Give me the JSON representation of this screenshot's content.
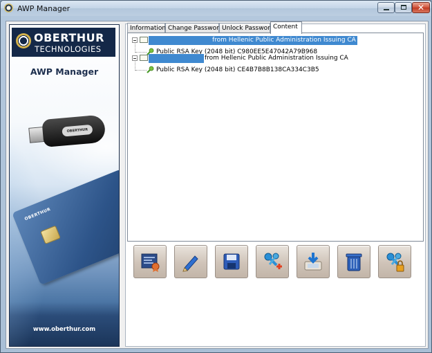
{
  "window": {
    "title": "AWP Manager"
  },
  "banner": {
    "logo_word": "OBERTHUR",
    "logo_sub": "TECHNOLOGIES",
    "app_name": "AWP Manager",
    "usb_label": "OBERTHUR",
    "card_logo": "OBERTHUR",
    "url": "www.oberthur.com"
  },
  "tabs": [
    {
      "label": "Information",
      "active": false
    },
    {
      "label": "Change Password",
      "active": false
    },
    {
      "label": "Unlock Password",
      "active": false
    },
    {
      "label": "Content",
      "active": true
    }
  ],
  "tree": [
    {
      "label_suffix": "from Hellenic Public Administration Issuing CA",
      "selected": true,
      "child": "Public RSA Key (2048 bit) C980EE5E47042A79B968"
    },
    {
      "label_suffix": "from Hellenic Public Administration Issuing CA",
      "selected": false,
      "child": "Public RSA Key (2048 bit) CE4B7B8B138CA334C3B5"
    }
  ],
  "toolbar": [
    {
      "name": "view-certificate",
      "icon": "certificate-icon"
    },
    {
      "name": "edit",
      "icon": "pencil-icon"
    },
    {
      "name": "save",
      "icon": "floppy-disk-icon"
    },
    {
      "name": "generate-keys",
      "icon": "keys-plus-icon"
    },
    {
      "name": "import",
      "icon": "import-tray-icon"
    },
    {
      "name": "delete",
      "icon": "trash-icon"
    },
    {
      "name": "lock-keys",
      "icon": "keys-lock-icon"
    }
  ],
  "colors": {
    "selection": "#3f89d0",
    "arrow": "#d40000",
    "banner_navy": "#142848"
  }
}
